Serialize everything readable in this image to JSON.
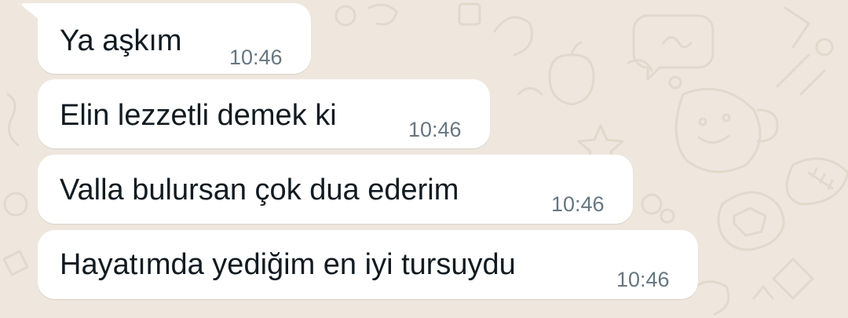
{
  "chat": {
    "messages": [
      {
        "text": "Ya aşkım",
        "time": "10:46"
      },
      {
        "text": "Elin lezzetli demek ki",
        "time": "10:46"
      },
      {
        "text": "Valla bulursan çok dua ederim",
        "time": "10:46"
      },
      {
        "text": "Hayatımda yediğim en iyi tursuydu",
        "time": "10:46"
      }
    ]
  },
  "colors": {
    "wallpaper": "#EFE7DE",
    "doodle": "#E2D8CC",
    "bubble": "#FFFFFF",
    "text": "#111B21",
    "time": "#667781"
  }
}
